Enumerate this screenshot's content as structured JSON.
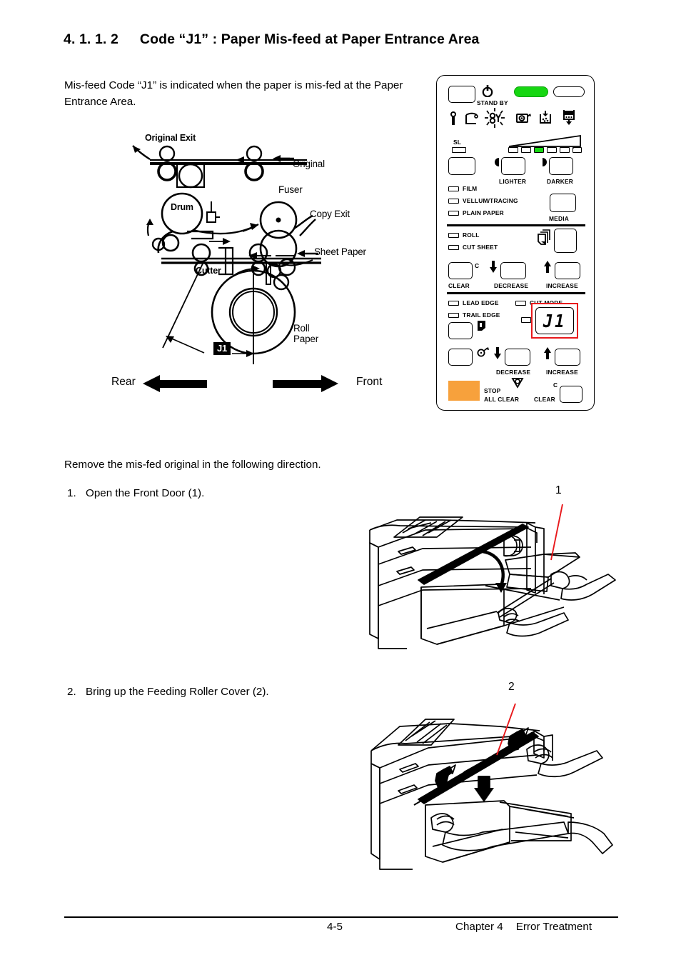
{
  "heading": {
    "number": "4. 1. 1. 2",
    "title": "Code “J1” : Paper Mis-feed at Paper Entrance Area"
  },
  "intro": "Mis-feed Code “J1” is indicated when the paper is mis-fed at the Paper Entrance Area.",
  "instructions": {
    "lead": "Remove the mis-fed original in the following direction.",
    "steps": [
      {
        "number": "1.",
        "text": "Open the Front Door (1)."
      },
      {
        "number": "2.",
        "text": "Bring up the Feeding Roller Cover (2)."
      }
    ]
  },
  "paper_path": {
    "labels": {
      "original_exit": "Original Exit",
      "original": "Original",
      "fuser": "Fuser",
      "copy_exit": "Copy Exit",
      "drum": "Drum",
      "sheet_paper": "Sheet Paper",
      "cutter": "Cutter",
      "roll_paper_line1": "Roll",
      "roll_paper_line2": "Paper",
      "jam_code": "J1"
    },
    "direction": {
      "rear": "Rear",
      "front": "Front"
    }
  },
  "control_panel": {
    "standby_label": "STAND BY",
    "standby_led_color": "#16d612",
    "sl_label": "SL",
    "density": {
      "lighter": "LIGHTER",
      "darker": "DARKER",
      "led_count": 7,
      "active_led_index": 3,
      "active_color": "#16d612"
    },
    "media": {
      "options": [
        "FILM",
        "VELLUM/TRACING",
        "PLAIN PAPER"
      ],
      "button_label": "MEDIA"
    },
    "supply": {
      "options": [
        "ROLL",
        "CUT SHEET"
      ],
      "clear_label": "CLEAR",
      "clear_badge": "C",
      "decrease_label": "DECREASE",
      "increase_label": "INCREASE"
    },
    "cut": {
      "lead_edge": "LEAD EDGE",
      "trail_edge": "TRAIL EDGE",
      "cut_mode": "CUT MODE",
      "decrease_label": "DECREASE",
      "increase_label": "INCREASE"
    },
    "display": {
      "value": "J1",
      "highlight_color": "#e8191c"
    },
    "stop": {
      "line1": "STOP",
      "line2": "ALL CLEAR",
      "color": "#f7a13c"
    },
    "clear": {
      "label": "CLEAR",
      "badge": "C"
    }
  },
  "figures": {
    "step1_callout": "1",
    "step2_callout": "2",
    "callout_line_color": "#e8191c"
  },
  "footer": {
    "page_number": "4-5",
    "chapter": "Chapter 4",
    "chapter_title": "Error Treatment"
  }
}
